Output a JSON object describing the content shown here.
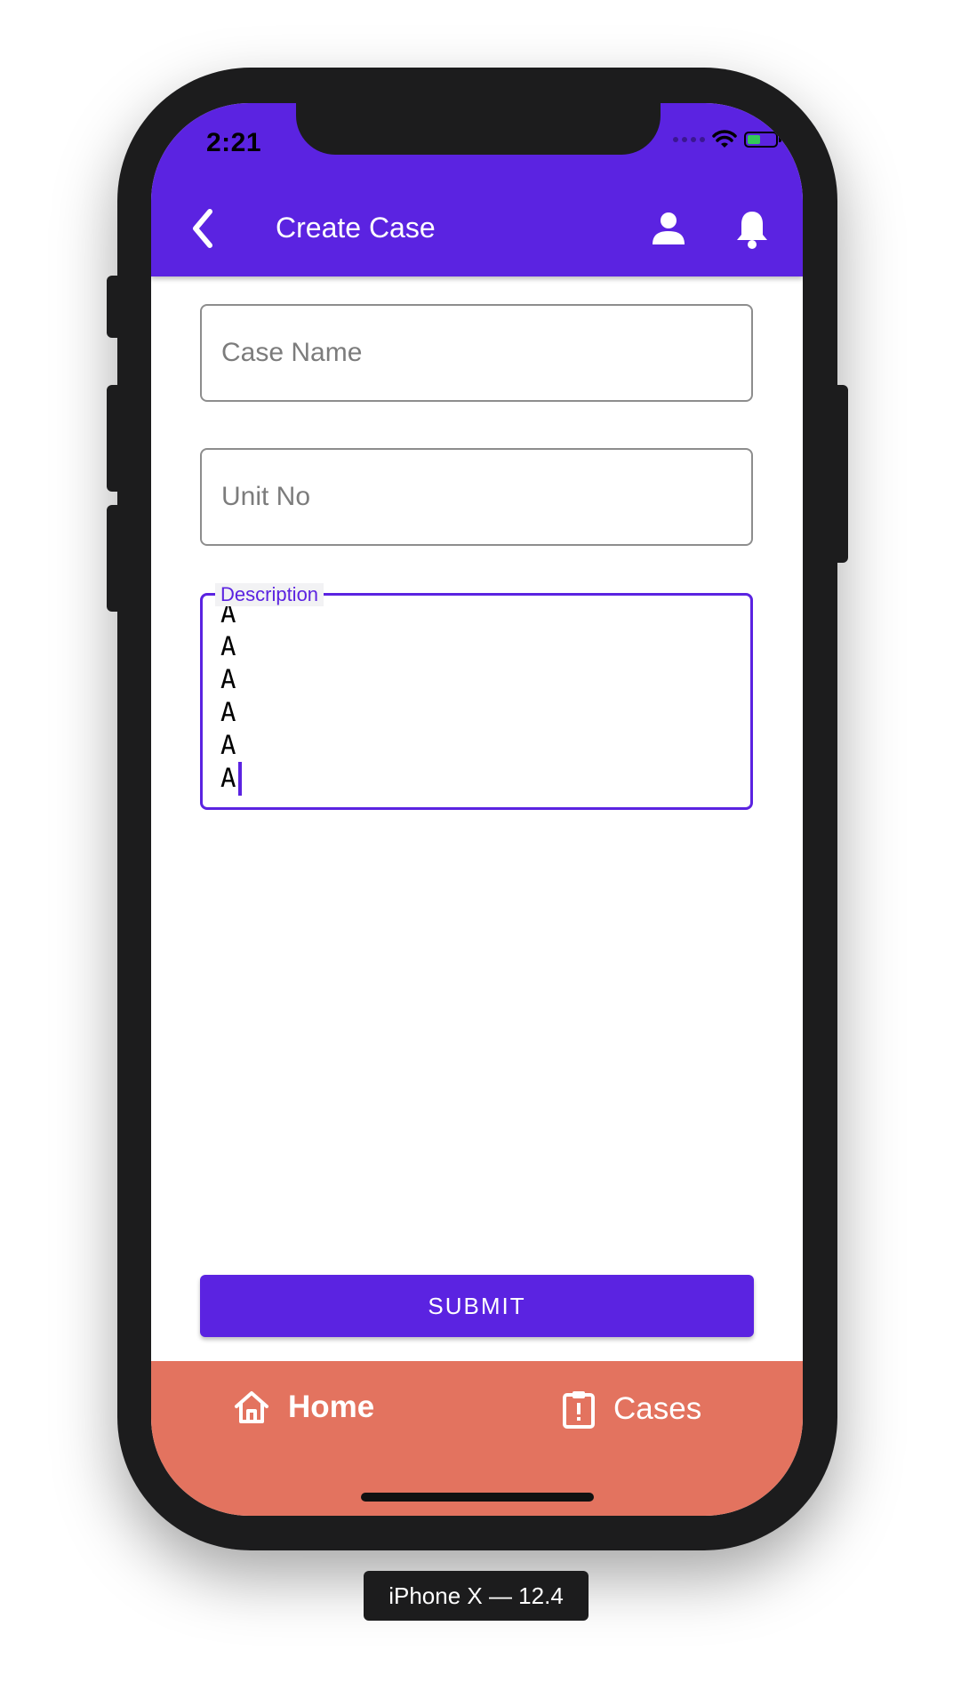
{
  "status_bar": {
    "time": "2:21"
  },
  "header": {
    "title": "Create Case"
  },
  "form": {
    "case_name": {
      "placeholder": "Case Name",
      "value": ""
    },
    "unit_no": {
      "placeholder": "Unit No",
      "value": ""
    },
    "description": {
      "label": "Description",
      "value": "A\nA\nA\nA\nA\nA"
    },
    "submit_label": "SUBMIT"
  },
  "tabs": [
    {
      "label": "Home",
      "icon": "home-icon",
      "active": true
    },
    {
      "label": "Cases",
      "icon": "clipboard-alert-icon",
      "active": false
    }
  ],
  "device_label": "iPhone X — 12.4",
  "colors": {
    "primary": "#5b23e1",
    "tabbar": "#e3735f",
    "device": "#1c1c1d"
  }
}
